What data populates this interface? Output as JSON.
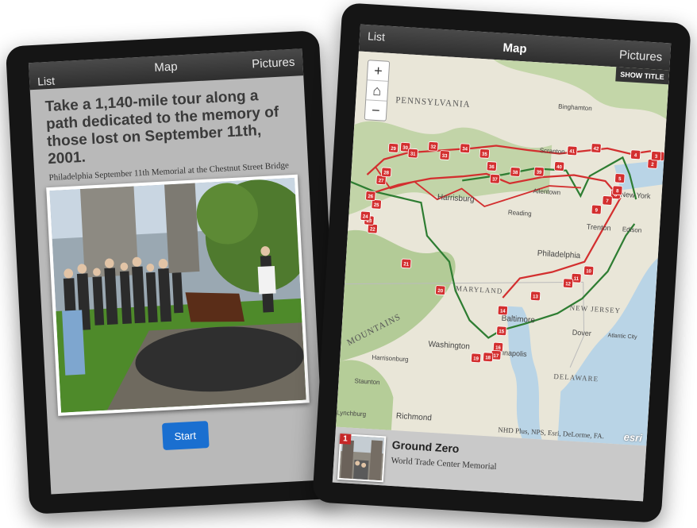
{
  "left_screen": {
    "nav": {
      "list": "List",
      "map": "Map",
      "pictures": "Pictures"
    },
    "headline": "Take a 1,140-mile tour along a path dedicated to the memory of those lost on September 11th, 2001.",
    "caption": "Philadelphia September 11th Memorial at the Chestnut Street Bridge",
    "start_label": "Start"
  },
  "right_screen": {
    "nav": {
      "list": "List",
      "map": "Map",
      "pictures": "Pictures"
    },
    "show_title_label": "SHOW TITLE",
    "zoom": {
      "plus": "+",
      "home_icon": "home-icon",
      "minus": "−"
    },
    "map_labels": {
      "pennsylvania": "PENNSYLVANIA",
      "binghamton": "Binghamton",
      "scranton": "Scranton",
      "harrisburg": "Harrisburg",
      "allentown": "Allentown",
      "reading": "Reading",
      "trenton": "Trenton",
      "new_york": "New York",
      "edison": "Edison",
      "philadelphia": "Philadelphia",
      "maryland": "MARYLAND",
      "new_jersey": "NEW JERSEY",
      "baltimore": "Baltimore",
      "dover": "Dover",
      "washington": "Washington",
      "annapolis": "Annapolis",
      "atlantic_city": "Atlantic City",
      "delaware": "DELAWARE",
      "harrisonburg": "Harrisonburg",
      "staunton": "Staunton",
      "lynchburg": "Lynchburg",
      "richmond": "Richmond",
      "mountains": "MOUNTAINS"
    },
    "attribution": "NHD Plus, NPS, Esri, DeLorme, FA.",
    "esri": "esri",
    "panel": {
      "number": "1",
      "title": "Ground Zero",
      "subtitle": "World Trade Center Memorial"
    },
    "markers": [
      "1",
      "2",
      "3",
      "4",
      "5",
      "6",
      "7",
      "8",
      "9",
      "10",
      "11",
      "12",
      "13",
      "14",
      "15",
      "16",
      "17",
      "18",
      "19",
      "20",
      "21",
      "22",
      "23",
      "24",
      "25",
      "26",
      "27",
      "28",
      "29",
      "30",
      "31",
      "32",
      "33",
      "34",
      "35",
      "36",
      "37",
      "38",
      "39",
      "40",
      "41",
      "42"
    ],
    "colors": {
      "route_red": "#d32f2f",
      "route_green": "#2e7d32",
      "accent_blue": "#1a6fd0"
    }
  }
}
